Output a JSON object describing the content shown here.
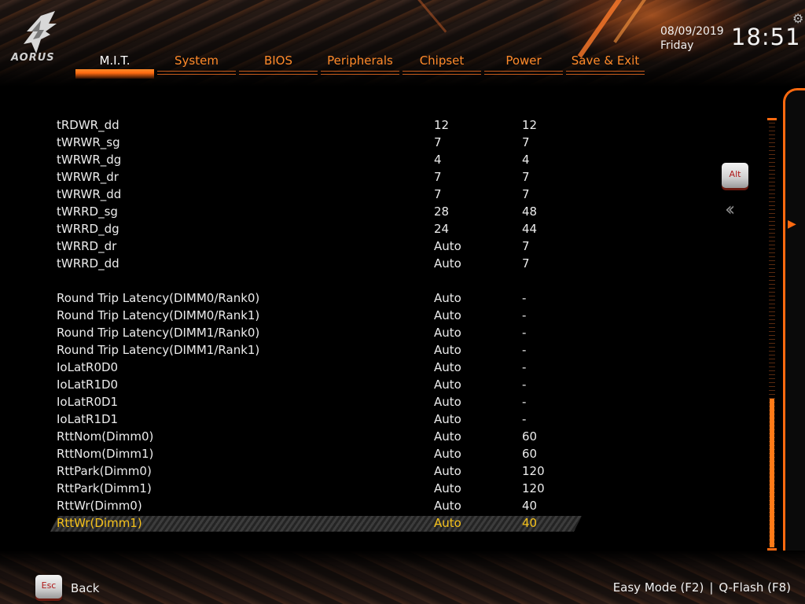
{
  "brand": {
    "logo_text": "AORUS"
  },
  "tabs": [
    {
      "label": "M.I.T.",
      "active": true
    },
    {
      "label": "System",
      "active": false
    },
    {
      "label": "BIOS",
      "active": false
    },
    {
      "label": "Peripherals",
      "active": false
    },
    {
      "label": "Chipset",
      "active": false
    },
    {
      "label": "Power",
      "active": false
    },
    {
      "label": "Save & Exit",
      "active": false
    }
  ],
  "datetime": {
    "date": "08/09/2019",
    "day": "Friday",
    "time": "18:51"
  },
  "settings": [
    {
      "name": "tRDWR_dd",
      "setting": "12",
      "current": "12"
    },
    {
      "name": "tWRWR_sg",
      "setting": "7",
      "current": "7"
    },
    {
      "name": "tWRWR_dg",
      "setting": "4",
      "current": "4"
    },
    {
      "name": "tWRWR_dr",
      "setting": "7",
      "current": "7"
    },
    {
      "name": "tWRWR_dd",
      "setting": "7",
      "current": "7"
    },
    {
      "name": "tWRRD_sg",
      "setting": "28",
      "current": "48"
    },
    {
      "name": "tWRRD_dg",
      "setting": "24",
      "current": "44"
    },
    {
      "name": "tWRRD_dr",
      "setting": "Auto",
      "current": "7"
    },
    {
      "name": "tWRRD_dd",
      "setting": "Auto",
      "current": "7"
    },
    {
      "name": "",
      "setting": "",
      "current": ""
    },
    {
      "name": "Round Trip Latency(DIMM0/Rank0)",
      "setting": "Auto",
      "current": "-"
    },
    {
      "name": "Round Trip Latency(DIMM0/Rank1)",
      "setting": "Auto",
      "current": "-"
    },
    {
      "name": "Round Trip Latency(DIMM1/Rank0)",
      "setting": "Auto",
      "current": "-"
    },
    {
      "name": "Round Trip Latency(DIMM1/Rank1)",
      "setting": "Auto",
      "current": "-"
    },
    {
      "name": "IoLatR0D0",
      "setting": "Auto",
      "current": "-"
    },
    {
      "name": "IoLatR1D0",
      "setting": "Auto",
      "current": "-"
    },
    {
      "name": "IoLatR0D1",
      "setting": "Auto",
      "current": "-"
    },
    {
      "name": "IoLatR1D1",
      "setting": "Auto",
      "current": "-"
    },
    {
      "name": "RttNom(Dimm0)",
      "setting": "Auto",
      "current": "60"
    },
    {
      "name": "RttNom(Dimm1)",
      "setting": "Auto",
      "current": "60"
    },
    {
      "name": "RttPark(Dimm0)",
      "setting": "Auto",
      "current": "120"
    },
    {
      "name": "RttPark(Dimm1)",
      "setting": "Auto",
      "current": "120"
    },
    {
      "name": "RttWr(Dimm0)",
      "setting": "Auto",
      "current": "40"
    },
    {
      "name": "RttWr(Dimm1)",
      "setting": "Auto",
      "current": "40",
      "selected": true
    }
  ],
  "side": {
    "alt_key": "Alt"
  },
  "scrollbar": {
    "thumb_start": 0.65,
    "thumb_end": 1.0
  },
  "footer": {
    "esc_key": "Esc",
    "back_label": "Back",
    "easy_mode": "Easy Mode (F2)",
    "separator": "|",
    "qflash": "Q-Flash (F8)"
  },
  "colors": {
    "accent": "#ff6a10",
    "tab_text": "#ff8a2a",
    "selected_text": "#f6c21a"
  }
}
